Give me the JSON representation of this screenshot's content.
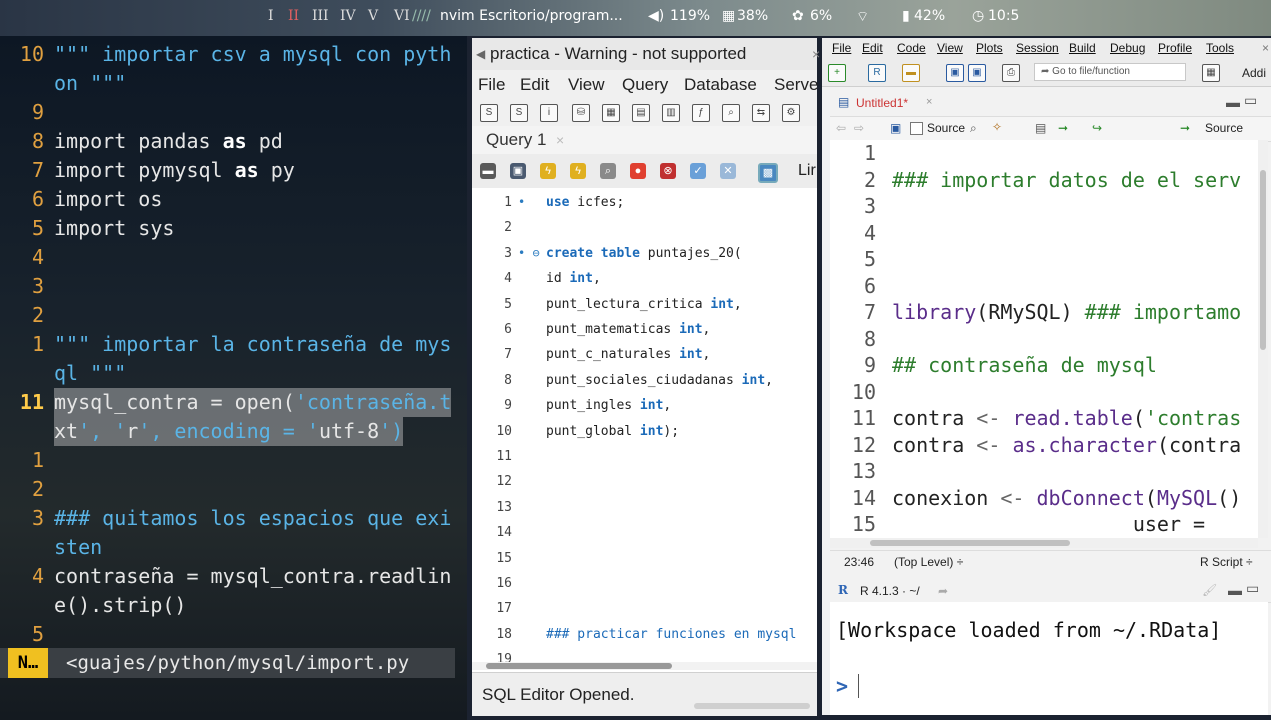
{
  "topbar": {
    "workspaces": [
      "I",
      "II",
      "III",
      "IV",
      "V",
      "VI"
    ],
    "active_workspace": "II",
    "separators": "////",
    "window_title": "nvim Escritorio/program...",
    "volume": "119%",
    "cpu": "38%",
    "memory": "6%",
    "battery": "42%",
    "clock": "10:5"
  },
  "nvim": {
    "lines": [
      {
        "num": "10",
        "text": "\"\"\" importar csv a mysql con pyth",
        "kind": "str"
      },
      {
        "num": "",
        "text": "on \"\"\"",
        "kind": "str"
      },
      {
        "num": "9",
        "text": "",
        "kind": "plain"
      },
      {
        "num": "8",
        "text": "import pandas as pd",
        "kind": "import_as"
      },
      {
        "num": "7",
        "text": "import pymysql as py",
        "kind": "import_as"
      },
      {
        "num": "6",
        "text": "import os",
        "kind": "import"
      },
      {
        "num": "5",
        "text": "import sys",
        "kind": "import"
      },
      {
        "num": "4",
        "text": "",
        "kind": "plain"
      },
      {
        "num": "3",
        "text": "",
        "kind": "plain"
      },
      {
        "num": "2",
        "text": "",
        "kind": "plain"
      },
      {
        "num": "1",
        "text": "\"\"\" importar la contraseña de mys",
        "kind": "str"
      },
      {
        "num": "",
        "text": "ql \"\"\"",
        "kind": "str"
      },
      {
        "num": "11",
        "text": "mysql_contra = open('contraseña.t",
        "kind": "current"
      },
      {
        "num": "",
        "text": "xt', 'r', encoding = 'utf-8')",
        "kind": "current"
      },
      {
        "num": "1",
        "text": "",
        "kind": "plain"
      },
      {
        "num": "2",
        "text": "",
        "kind": "plain"
      },
      {
        "num": "3",
        "text": "### quitamos los espacios que exi",
        "kind": "cmt"
      },
      {
        "num": "",
        "text": "sten",
        "kind": "cmt"
      },
      {
        "num": "4",
        "text": "contraseña = mysql_contra.readlin",
        "kind": "plain"
      },
      {
        "num": "",
        "text": "e().strip()",
        "kind": "plain"
      },
      {
        "num": "5",
        "text": "",
        "kind": "plain"
      }
    ],
    "mode": "N…",
    "file_path": "<guajes/python/mysql/import.py"
  },
  "workbench": {
    "tab_title": "practica - Warning - not supported",
    "menu": [
      "File",
      "Edit",
      "View",
      "Query",
      "Database",
      "Serve"
    ],
    "query_tab": "Query 1",
    "limit_label": "Lir",
    "sql_lines": [
      {
        "num": "1",
        "dot": "•",
        "text": "use icfes;"
      },
      {
        "num": "2",
        "dot": "",
        "text": ""
      },
      {
        "num": "3",
        "dot": "• ⊖",
        "text": "create table puntajes_20("
      },
      {
        "num": "4",
        "dot": "",
        "text": "id int,"
      },
      {
        "num": "5",
        "dot": "",
        "text": "punt_lectura_critica int,"
      },
      {
        "num": "6",
        "dot": "",
        "text": "punt_matematicas int,"
      },
      {
        "num": "7",
        "dot": "",
        "text": "punt_c_naturales int,"
      },
      {
        "num": "8",
        "dot": "",
        "text": "punt_sociales_ciudadanas int,"
      },
      {
        "num": "9",
        "dot": "",
        "text": "punt_ingles int,"
      },
      {
        "num": "10",
        "dot": "",
        "text": "punt_global int);"
      },
      {
        "num": "11",
        "dot": "",
        "text": ""
      },
      {
        "num": "12",
        "dot": "",
        "text": ""
      },
      {
        "num": "13",
        "dot": "",
        "text": ""
      },
      {
        "num": "14",
        "dot": "",
        "text": ""
      },
      {
        "num": "15",
        "dot": "",
        "text": ""
      },
      {
        "num": "16",
        "dot": "",
        "text": ""
      },
      {
        "num": "17",
        "dot": "",
        "text": ""
      },
      {
        "num": "18",
        "dot": "",
        "text": "### practicar funciones en mysql"
      },
      {
        "num": "19",
        "dot": "",
        "text": ""
      }
    ],
    "status": "SQL Editor Opened."
  },
  "rstudio": {
    "menu": [
      "File",
      "Edit",
      "Code",
      "View",
      "Plots",
      "Session",
      "Build",
      "Debug",
      "Profile",
      "Tools"
    ],
    "goto_placeholder": "Go to file/function",
    "addins": "Addi",
    "editor_tab": "Untitled1*",
    "source_on_save": "Source",
    "source_btn": "Source",
    "code_lines": [
      {
        "num": "1",
        "text": ""
      },
      {
        "num": "2",
        "text": "### importar datos de el serv"
      },
      {
        "num": "3",
        "text": ""
      },
      {
        "num": "4",
        "text": ""
      },
      {
        "num": "5",
        "text": ""
      },
      {
        "num": "6",
        "text": ""
      },
      {
        "num": "7",
        "text": "library(RMySQL) ### importamo"
      },
      {
        "num": "8",
        "text": ""
      },
      {
        "num": "9",
        "text": "## contraseña de mysql"
      },
      {
        "num": "10",
        "text": ""
      },
      {
        "num": "11",
        "text": "contra <- read.table('contras"
      },
      {
        "num": "12",
        "text": "contra <- as.character(contra"
      },
      {
        "num": "13",
        "text": ""
      },
      {
        "num": "14",
        "text": "conexion <- dbConnect(MySQL()"
      },
      {
        "num": "15",
        "text": "                    user = "
      }
    ],
    "cursor_pos": "23:46",
    "scope": "(Top Level) ÷",
    "file_type": "R Script ÷",
    "r_version": "R 4.1.3 · ~/",
    "console_line": "[Workspace loaded from ~/.RData]",
    "prompt": ">"
  }
}
